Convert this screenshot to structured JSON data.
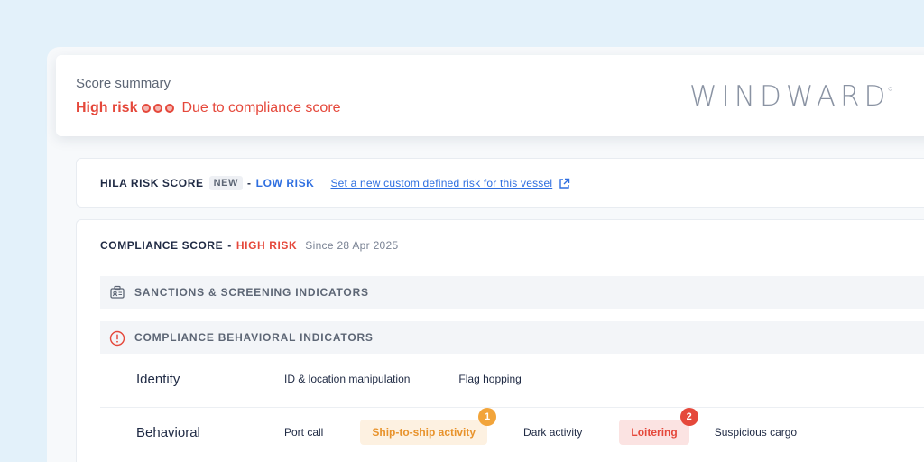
{
  "summary": {
    "title": "Score summary",
    "risk_level": "High risk",
    "reason": "Due to compliance score",
    "brand": "WINDWARD",
    "brand_mark": "○"
  },
  "hila": {
    "label": "HILA RISK SCORE",
    "badge": "NEW",
    "separator": "-",
    "risk": "LOW RISK",
    "link": "Set a new custom defined risk for this vessel"
  },
  "compliance": {
    "label": "COMPLIANCE SCORE",
    "separator": "-",
    "risk": "HIGH RISK",
    "since": "Since 28 Apr 2025",
    "sections": {
      "sanctions": "SANCTIONS & SCREENING INDICATORS",
      "behavioral": "COMPLIANCE BEHAVIORAL INDICATORS"
    },
    "rows": {
      "identity": {
        "label": "Identity",
        "items": [
          "ID & location manipulation",
          "Flag hopping"
        ]
      },
      "behavioral": {
        "label": "Behavioral",
        "items": [
          {
            "label": "Port call"
          },
          {
            "label": "Ship-to-ship activity",
            "count": "1"
          },
          {
            "label": "Dark activity"
          },
          {
            "label": "Loitering",
            "count": "2"
          },
          {
            "label": "Suspicious cargo"
          }
        ]
      }
    }
  },
  "colors": {
    "high_risk": "#e5483b",
    "low_risk": "#2f6fe0",
    "warning": "#f2a43a",
    "background": "#e3f1fa"
  }
}
